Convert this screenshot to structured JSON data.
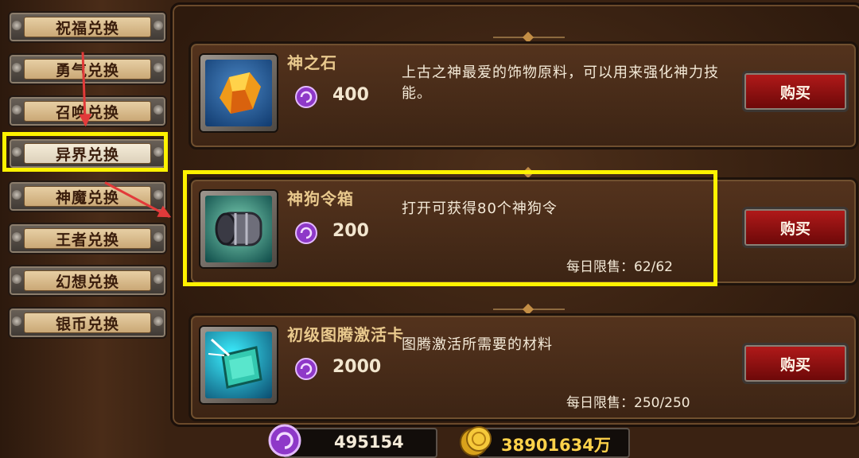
{
  "menu": [
    {
      "label": "祝福兑换"
    },
    {
      "label": "勇气兑换"
    },
    {
      "label": "召唤兑换"
    },
    {
      "label": "异界兑换",
      "active": true
    },
    {
      "label": "神魔兑换"
    },
    {
      "label": "王者兑换"
    },
    {
      "label": "幻想兑换"
    },
    {
      "label": "银币兑换"
    }
  ],
  "items": [
    {
      "name": "神之石",
      "price": "400",
      "desc": "上古之神最爱的饰物原料，可以用来强化神力技能。",
      "limit": "",
      "buy": "购买",
      "icon": "god-stone-icon"
    },
    {
      "name": "神狗令箱",
      "price": "200",
      "desc": "打开可获得80个神狗令",
      "limit": "每日限售：62/62",
      "buy": "购买",
      "icon": "token-box-icon"
    },
    {
      "name": "初级图腾激活卡",
      "price": "2000",
      "desc": "图腾激活所需要的材料",
      "limit": "每日限售：250/250",
      "buy": "购买",
      "icon": "totem-card-icon"
    }
  ],
  "currency": {
    "gems": "495154",
    "gold": "38901634万"
  },
  "colors": {
    "highlight": "#fff200",
    "arrow": "#e23a3a",
    "buy_button": "#b31a1a"
  }
}
